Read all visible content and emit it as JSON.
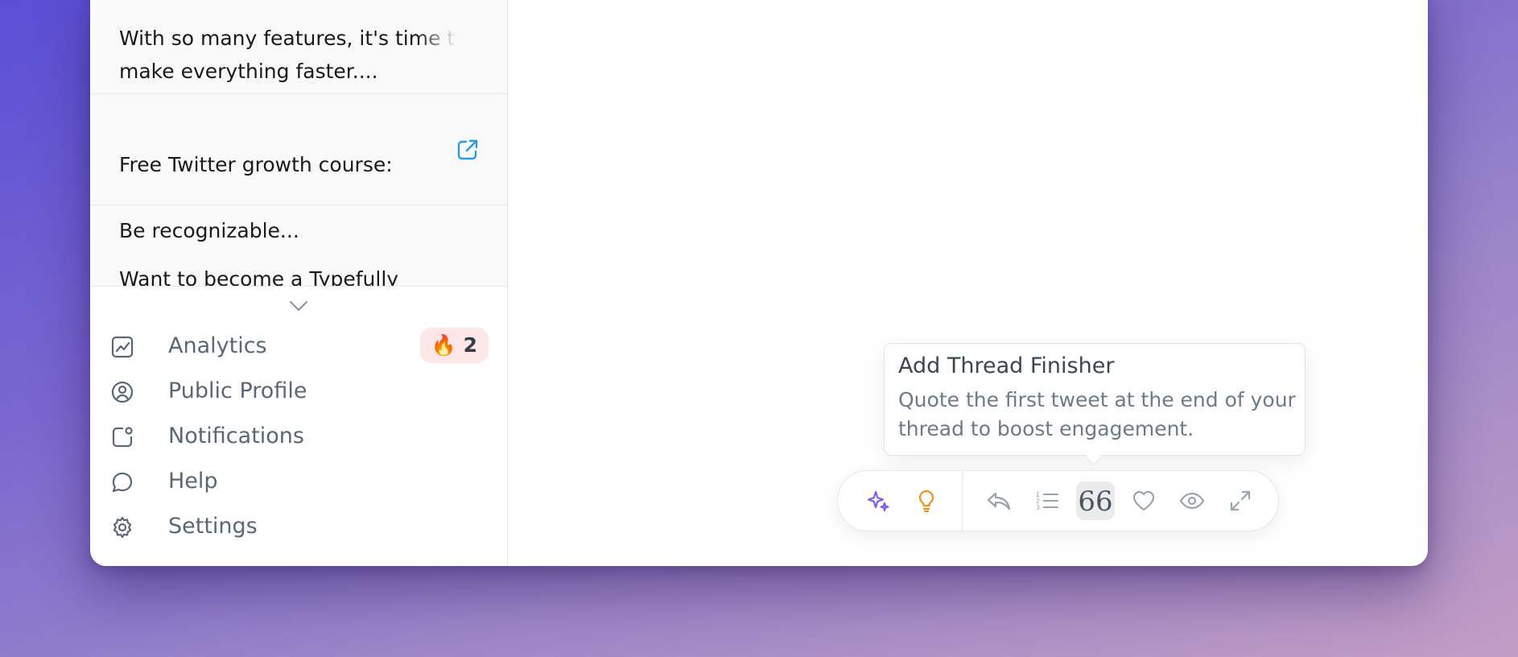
{
  "feed": {
    "items": [
      {
        "line1": "With so many features, it's time to",
        "line2": "make everything faster...."
      },
      {
        "line1": "Free Twitter growth course:",
        "line2": "Be recognizable...",
        "icon": "external-link-icon"
      },
      {
        "line1": "Want to become a Typefully",
        "line2": ""
      }
    ]
  },
  "nav": {
    "analytics": {
      "label": "Analytics",
      "badge_emoji": "🔥",
      "badge_count": "2"
    },
    "public_profile": {
      "label": "Public Profile"
    },
    "notifications": {
      "label": "Notifications"
    },
    "help": {
      "label": "Help"
    },
    "settings": {
      "label": "Settings"
    }
  },
  "tooltip": {
    "title": "Add Thread Finisher",
    "body": "Quote the first tweet at the end of your thread to boost engagement."
  },
  "toolbar": {
    "buttons": [
      {
        "name": "ai-sparkle-icon",
        "color": "#7c5ce8"
      },
      {
        "name": "lightbulb-icon",
        "color": "#f0931e"
      },
      {
        "name": "reply-icon"
      },
      {
        "name": "numbered-list-icon"
      },
      {
        "name": "thread-finisher-quote-icon",
        "glyph": "66",
        "active": true
      },
      {
        "name": "heart-icon"
      },
      {
        "name": "eye-icon"
      },
      {
        "name": "expand-icon"
      }
    ]
  },
  "colors": {
    "link_icon": "#2a9be0",
    "nav_text": "#5b6776",
    "badge_bg": "#fde7e7",
    "toolbar_icon": "#9aa3ad"
  }
}
